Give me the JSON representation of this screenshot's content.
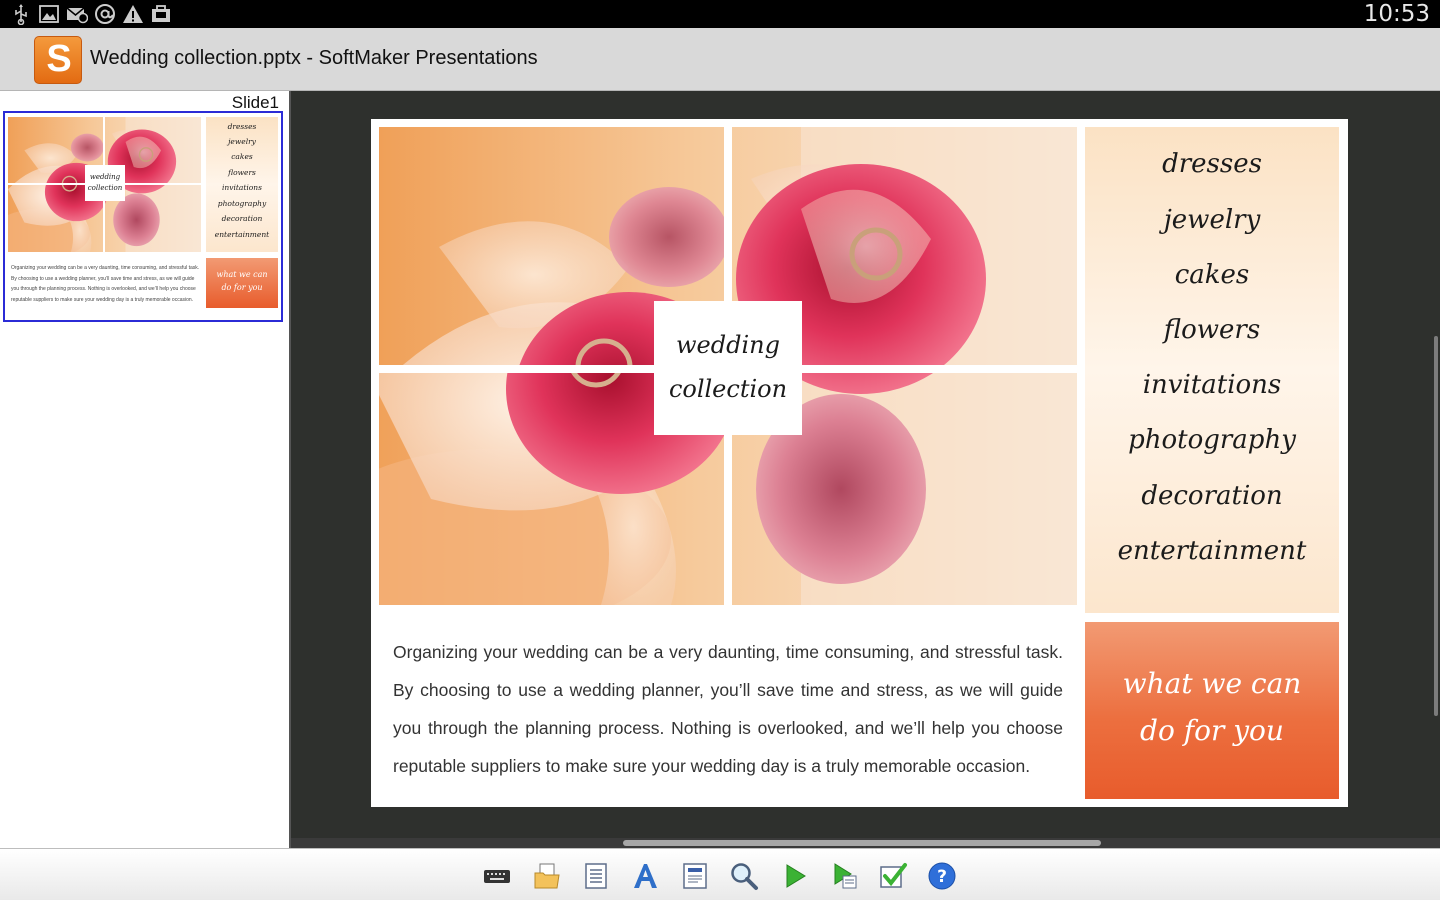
{
  "status_bar": {
    "time": "10:53",
    "icons": [
      "usb-icon",
      "image-icon",
      "mail-sync-icon",
      "at-icon",
      "warning-icon",
      "briefcase-icon"
    ]
  },
  "window": {
    "app_logo_letter": "S",
    "title": "Wedding collection.pptx - SoftMaker Presentations"
  },
  "slide_panel": {
    "slides": [
      {
        "label": "Slide1"
      }
    ]
  },
  "slide": {
    "center_title_line1": "wedding",
    "center_title_line2": "collection",
    "menu_items": [
      "dresses",
      "jewelry",
      "cakes",
      "flowers",
      "invitations",
      "photography",
      "decoration",
      "entertainment"
    ],
    "body": "Organizing your wedding can be a very daunting, time consuming, and stressful task. By choosing to use a wedding planner, you’ll save time and stress, as we will guide you through the planning process. Nothing is overlooked, and we’ll help you choose reputable suppliers to make sure your wedding day is a truly memorable occasion.",
    "cta_line1": "what we can",
    "cta_line2": "do for you"
  },
  "toolbar": {
    "tools": [
      "keyboard-icon",
      "open-folder-icon",
      "document-icon",
      "font-icon",
      "slide-layout-icon",
      "search-icon",
      "play-icon",
      "play-from-slide-icon",
      "check-icon",
      "help-icon"
    ]
  },
  "colors": {
    "accent_orange": "#e85c2c",
    "selection_blue": "#2b2bd6",
    "workspace_bg": "#2e302d"
  }
}
